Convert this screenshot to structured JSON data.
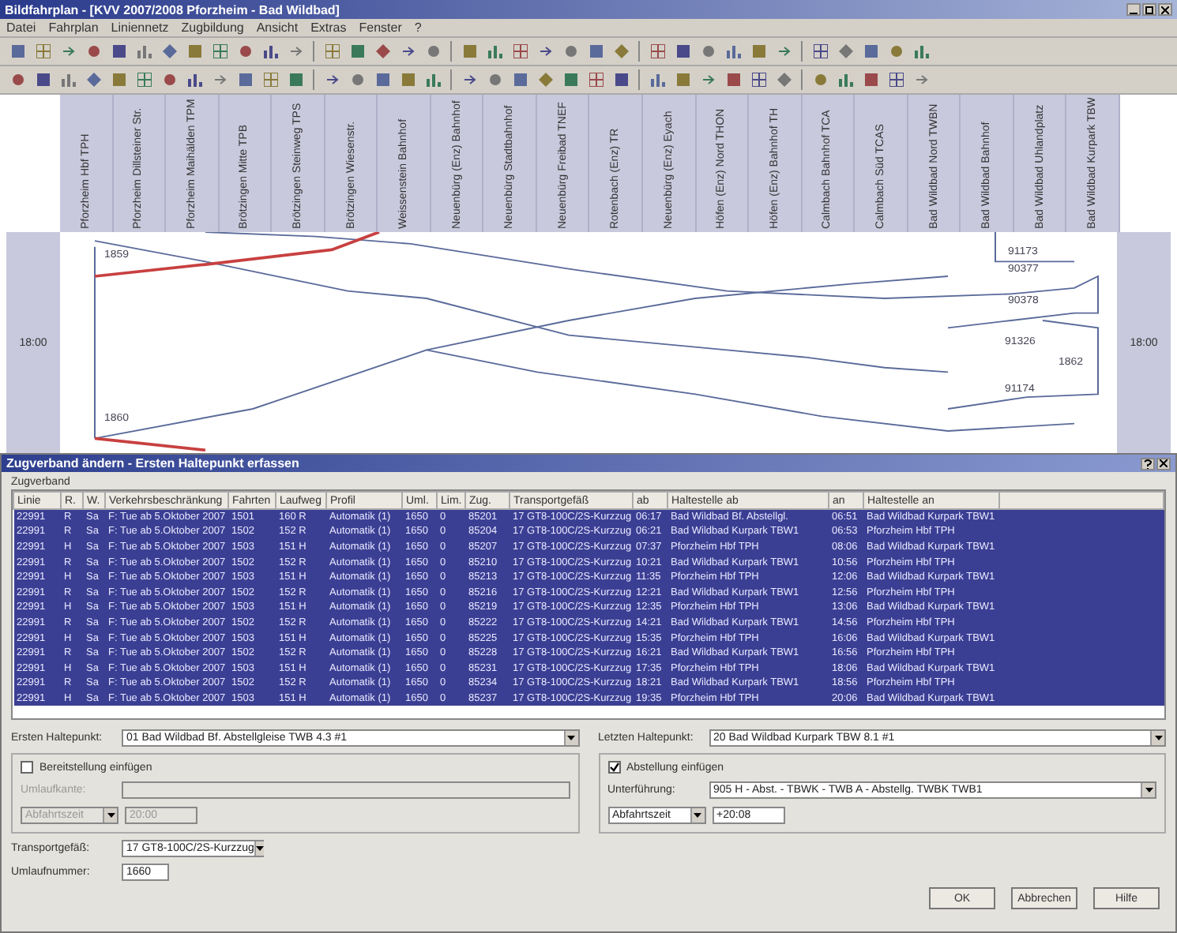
{
  "window": {
    "title": "Bildfahrplan - [KVV 2007/2008 Pforzheim - Bad Wildbad]"
  },
  "menu": [
    "Datei",
    "Fahrplan",
    "Liniennetz",
    "Zugbildung",
    "Ansicht",
    "Extras",
    "Fenster",
    "?"
  ],
  "stations": [
    "Pforzheim Hbf TPH",
    "Pforzheim Dillsteiner Str.",
    "Pforzheim Maihälden TPM",
    "Brötzingen Mitte TPB",
    "Brötzingen Steinweg TPS",
    "Brötzingen Wiesenstr.",
    "Weissenstein Bahnhof",
    "Neuenbürg (Enz) Bahnhof",
    "Neuenbürg Stadtbahnhof",
    "Neuenbürg Freibad TNEF",
    "Rotenbach (Enz) TR",
    "Neuenbürg (Enz) Eyach",
    "Höfen (Enz) Nord THON",
    "Höfen (Enz) Bahnhof TH",
    "Calmbach Bahnhof TCA",
    "Calmbach Süd TCAS",
    "Bad Wildbad Nord TWBN",
    "Bad Wildbad Bahnhof",
    "Bad Wildbad Uhlandplatz",
    "Bad Wildbad Kurpark TBW"
  ],
  "graph": {
    "time_labels": [
      "18:00",
      "18:00"
    ],
    "train_labels": [
      "1859",
      "1860",
      "91173",
      "90377",
      "90378",
      "91326",
      "1862",
      "91174"
    ]
  },
  "dialog": {
    "title": "Zugverband ändern - Ersten Haltepunkt erfassen",
    "group": "Zugverband",
    "columns": [
      "Linie",
      "R.",
      "W.",
      "Verkehrsbeschränkung",
      "Fahrten",
      "Laufweg",
      "Profil",
      "Uml.",
      "Lim.",
      "Zug.",
      "Transportgefäß",
      "ab",
      "Haltestelle ab",
      "an",
      "Haltestelle an"
    ],
    "rows": [
      {
        "selected": true,
        "cells": [
          "22991",
          "R",
          "Sa",
          "F: Tue ab 5.Oktober 2007",
          "1501",
          "160 R",
          "Automatik (1)",
          "1650",
          "0",
          "85201",
          "17 GT8-100C/2S-Kurzzug",
          "06:17",
          "Bad Wildbad Bf. Abstellgl.",
          "06:51",
          "Bad Wildbad Kurpark TBW1"
        ]
      },
      {
        "selected": true,
        "cells": [
          "22991",
          "R",
          "Sa",
          "F: Tue ab 5.Oktober 2007",
          "1502",
          "152 R",
          "Automatik (1)",
          "1650",
          "0",
          "85204",
          "17 GT8-100C/2S-Kurzzug",
          "06:21",
          "Bad Wildbad Kurpark TBW1",
          "06:53",
          "Pforzheim Hbf TPH"
        ]
      },
      {
        "selected": true,
        "cells": [
          "22991",
          "H",
          "Sa",
          "F: Tue ab 5.Oktober 2007",
          "1503",
          "151 H",
          "Automatik (1)",
          "1650",
          "0",
          "85207",
          "17 GT8-100C/2S-Kurzzug",
          "07:37",
          "Pforzheim Hbf TPH",
          "08:06",
          "Bad Wildbad Kurpark TBW1"
        ]
      },
      {
        "selected": true,
        "cells": [
          "22991",
          "R",
          "Sa",
          "F: Tue ab 5.Oktober 2007",
          "1502",
          "152 R",
          "Automatik (1)",
          "1650",
          "0",
          "85210",
          "17 GT8-100C/2S-Kurzzug",
          "10:21",
          "Bad Wildbad Kurpark TBW1",
          "10:56",
          "Pforzheim Hbf TPH"
        ]
      },
      {
        "selected": true,
        "cells": [
          "22991",
          "H",
          "Sa",
          "F: Tue ab 5.Oktober 2007",
          "1503",
          "151 H",
          "Automatik (1)",
          "1650",
          "0",
          "85213",
          "17 GT8-100C/2S-Kurzzug",
          "11:35",
          "Pforzheim Hbf TPH",
          "12:06",
          "Bad Wildbad Kurpark TBW1"
        ]
      },
      {
        "selected": true,
        "cells": [
          "22991",
          "R",
          "Sa",
          "F: Tue ab 5.Oktober 2007",
          "1502",
          "152 R",
          "Automatik (1)",
          "1650",
          "0",
          "85216",
          "17 GT8-100C/2S-Kurzzug",
          "12:21",
          "Bad Wildbad Kurpark TBW1",
          "12:56",
          "Pforzheim Hbf TPH"
        ]
      },
      {
        "selected": true,
        "cells": [
          "22991",
          "H",
          "Sa",
          "F: Tue ab 5.Oktober 2007",
          "1503",
          "151 H",
          "Automatik (1)",
          "1650",
          "0",
          "85219",
          "17 GT8-100C/2S-Kurzzug",
          "12:35",
          "Pforzheim Hbf TPH",
          "13:06",
          "Bad Wildbad Kurpark TBW1"
        ]
      },
      {
        "selected": true,
        "cells": [
          "22991",
          "R",
          "Sa",
          "F: Tue ab 5.Oktober 2007",
          "1502",
          "152 R",
          "Automatik (1)",
          "1650",
          "0",
          "85222",
          "17 GT8-100C/2S-Kurzzug",
          "14:21",
          "Bad Wildbad Kurpark TBW1",
          "14:56",
          "Pforzheim Hbf TPH"
        ]
      },
      {
        "selected": true,
        "cells": [
          "22991",
          "H",
          "Sa",
          "F: Tue ab 5.Oktober 2007",
          "1503",
          "151 H",
          "Automatik (1)",
          "1650",
          "0",
          "85225",
          "17 GT8-100C/2S-Kurzzug",
          "15:35",
          "Pforzheim Hbf TPH",
          "16:06",
          "Bad Wildbad Kurpark TBW1"
        ]
      },
      {
        "selected": true,
        "cells": [
          "22991",
          "R",
          "Sa",
          "F: Tue ab 5.Oktober 2007",
          "1502",
          "152 R",
          "Automatik (1)",
          "1650",
          "0",
          "85228",
          "17 GT8-100C/2S-Kurzzug",
          "16:21",
          "Bad Wildbad Kurpark TBW1",
          "16:56",
          "Pforzheim Hbf TPH"
        ]
      },
      {
        "selected": true,
        "cells": [
          "22991",
          "H",
          "Sa",
          "F: Tue ab 5.Oktober 2007",
          "1503",
          "151 H",
          "Automatik (1)",
          "1650",
          "0",
          "85231",
          "17 GT8-100C/2S-Kurzzug",
          "17:35",
          "Pforzheim Hbf TPH",
          "18:06",
          "Bad Wildbad Kurpark TBW1"
        ]
      },
      {
        "selected": true,
        "cells": [
          "22991",
          "R",
          "Sa",
          "F: Tue ab 5.Oktober 2007",
          "1502",
          "152 R",
          "Automatik (1)",
          "1650",
          "0",
          "85234",
          "17 GT8-100C/2S-Kurzzug",
          "18:21",
          "Bad Wildbad Kurpark TBW1",
          "18:56",
          "Pforzheim Hbf TPH"
        ]
      },
      {
        "selected": true,
        "cells": [
          "22991",
          "H",
          "Sa",
          "F: Tue ab 5.Oktober 2007",
          "1503",
          "151 H",
          "Automatik (1)",
          "1650",
          "0",
          "85237",
          "17 GT8-100C/2S-Kurzzug",
          "19:35",
          "Pforzheim Hbf TPH",
          "20:06",
          "Bad Wildbad Kurpark TBW1"
        ]
      }
    ],
    "first_stop": {
      "label": "Ersten Haltepunkt:",
      "value": "01 Bad Wildbad Bf. Abstellgleise TWB 4.3 #1"
    },
    "last_stop": {
      "label": "Letzten Haltepunkt:",
      "value": "20 Bad Wildbad Kurpark TBW 8.1 #1"
    },
    "provision": {
      "label": "Bereitstellung einfügen",
      "checked": false,
      "disabled": true,
      "circuit_label": "Umlaufkante:",
      "time_mode": "Abfahrtszeit",
      "time": "20:00"
    },
    "parking": {
      "label": "Abstellung einfügen",
      "checked": true,
      "disabled": false,
      "route_label": "Unterführung:",
      "route": "905 H - Abst. - TBWK - TWB A - Abstellg. TWBK TWB1",
      "time_mode": "Abfahrtszeit",
      "time": "+20:08"
    },
    "vehicle": {
      "label": "Transportgefäß:",
      "value": "17 GT8-100C/2S-Kurzzug"
    },
    "circuit": {
      "label": "Umlaufnummer:",
      "value": "1660"
    },
    "buttons": [
      "OK",
      "Abbrechen",
      "Hilfe"
    ]
  }
}
